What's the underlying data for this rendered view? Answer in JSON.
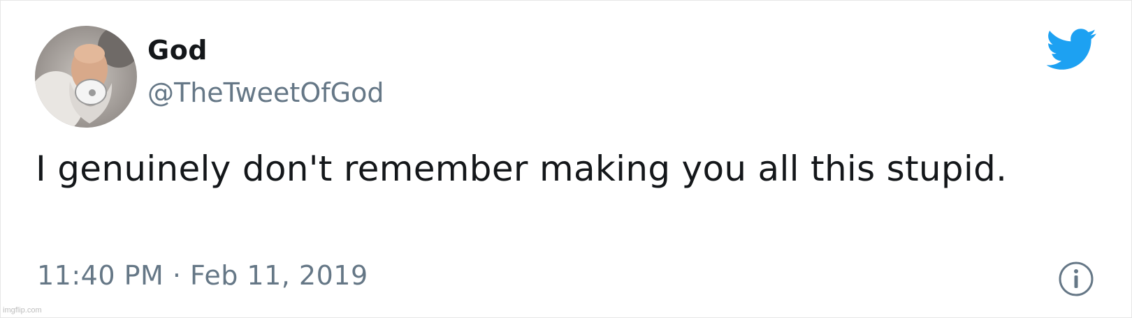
{
  "tweet": {
    "author_name": "God",
    "author_handle": "@TheTweetOfGod",
    "text": "I genuinely don't remember making you all this stupid.",
    "time": "11:40 PM",
    "separator": " · ",
    "date": "Feb 11, 2019"
  },
  "icons": {
    "brand": "twitter-bird-icon",
    "info": "info-icon"
  },
  "watermark": "imgflip.com",
  "colors": {
    "brand_blue": "#1da1f2",
    "text_primary": "#14171a",
    "text_secondary": "#657786"
  }
}
